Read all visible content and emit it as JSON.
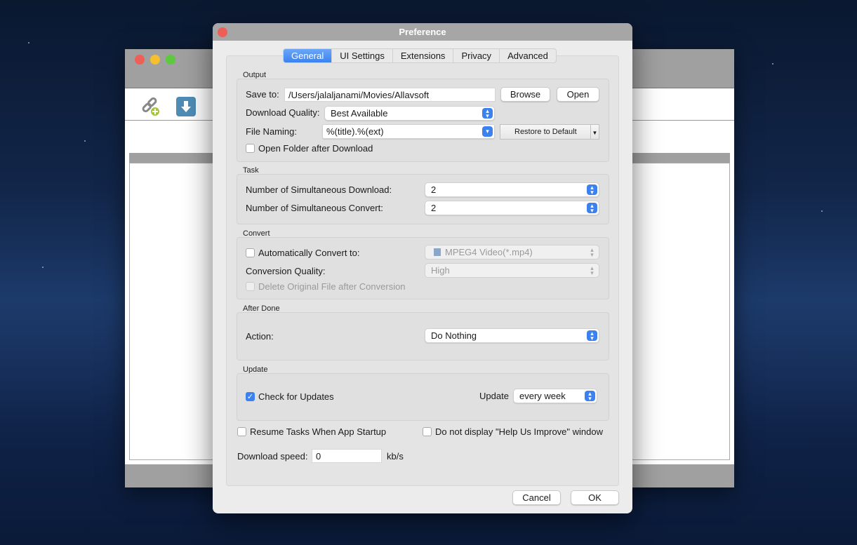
{
  "dialog": {
    "title": "Preference"
  },
  "tabs": [
    {
      "label": "General",
      "active": true
    },
    {
      "label": "UI Settings"
    },
    {
      "label": "Extensions"
    },
    {
      "label": "Privacy"
    },
    {
      "label": "Advanced"
    }
  ],
  "output": {
    "label": "Output",
    "save_to_label": "Save to:",
    "save_to_value": "/Users/jalaljanami/Movies/Allavsoft",
    "browse": "Browse",
    "open": "Open",
    "quality_label": "Download Quality:",
    "quality_value": "Best Available",
    "naming_label": "File Naming:",
    "naming_value": "%(title).%(ext)",
    "restore": "Restore to Default",
    "open_folder": "Open Folder after Download",
    "open_folder_checked": false
  },
  "task": {
    "label": "Task",
    "sim_download_label": "Number of Simultaneous Download:",
    "sim_download_value": "2",
    "sim_convert_label": "Number of Simultaneous Convert:",
    "sim_convert_value": "2"
  },
  "convert": {
    "label": "Convert",
    "auto_label": "Automatically Convert to:",
    "auto_checked": false,
    "format_value": "MPEG4 Video(*.mp4)",
    "quality_label": "Conversion Quality:",
    "quality_value": "High",
    "delete_label": "Delete Original File after Conversion"
  },
  "after_done": {
    "label": "After Done",
    "action_label": "Action:",
    "action_value": "Do Nothing"
  },
  "update": {
    "label": "Update",
    "check_label": "Check for Updates",
    "check_checked": true,
    "freq_label": "Update",
    "freq_value": "every week"
  },
  "misc": {
    "resume_label": "Resume Tasks When App Startup",
    "help_label": "Do not display \"Help Us Improve\" window",
    "speed_label": "Download speed:",
    "speed_value": "0",
    "speed_unit": "kb/s"
  },
  "buttons": {
    "cancel": "Cancel",
    "ok": "OK"
  },
  "colors": {
    "accent": "#3b82f0"
  }
}
